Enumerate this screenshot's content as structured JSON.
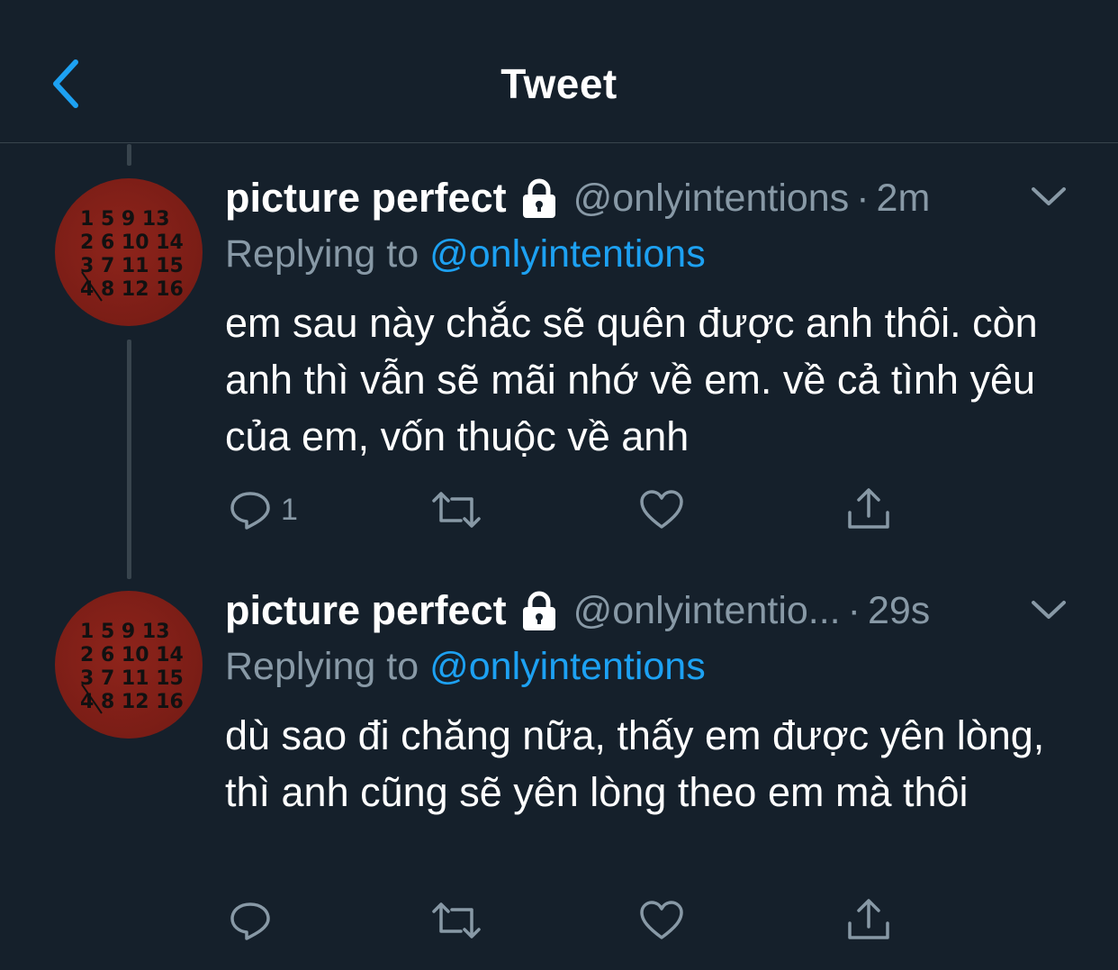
{
  "header": {
    "title": "Tweet",
    "back_icon": "chevron-left-icon"
  },
  "colors": {
    "background": "#15202b",
    "accent": "#1da1f2",
    "secondary_text": "#8899a6",
    "divider": "#38444d",
    "avatar": "#7a1d16"
  },
  "tweets": [
    {
      "display_name": "picture perfect",
      "locked_icon": "lock-icon",
      "handle": "@onlyintentions",
      "separator": "·",
      "time": "2m",
      "replying_label": "Replying to",
      "replying_to": "@onlyintentions",
      "text": "em sau này chắc sẽ quên được anh thôi. còn anh thì vẫn sẽ mãi nhớ về em. về cả tình yêu của em, vốn thuộc về anh",
      "reply_count": "1",
      "avatar_text": [
        "1 5 9 13",
        "2 6 10 14",
        "3 7 11 15",
        "4 8 12 16"
      ]
    },
    {
      "display_name": "picture perfect",
      "locked_icon": "lock-icon",
      "handle": "@onlyintentio...",
      "separator": "·",
      "time": "29s",
      "replying_label": "Replying to",
      "replying_to": "@onlyintentions",
      "text": "dù sao đi chăng nữa, thấy em được yên lòng, thì anh cũng sẽ yên lòng theo em mà thôi",
      "reply_count": "",
      "avatar_text": [
        "1 5 9 13",
        "2 6 10 14",
        "3 7 11 15",
        "4 8 12 16"
      ]
    }
  ]
}
